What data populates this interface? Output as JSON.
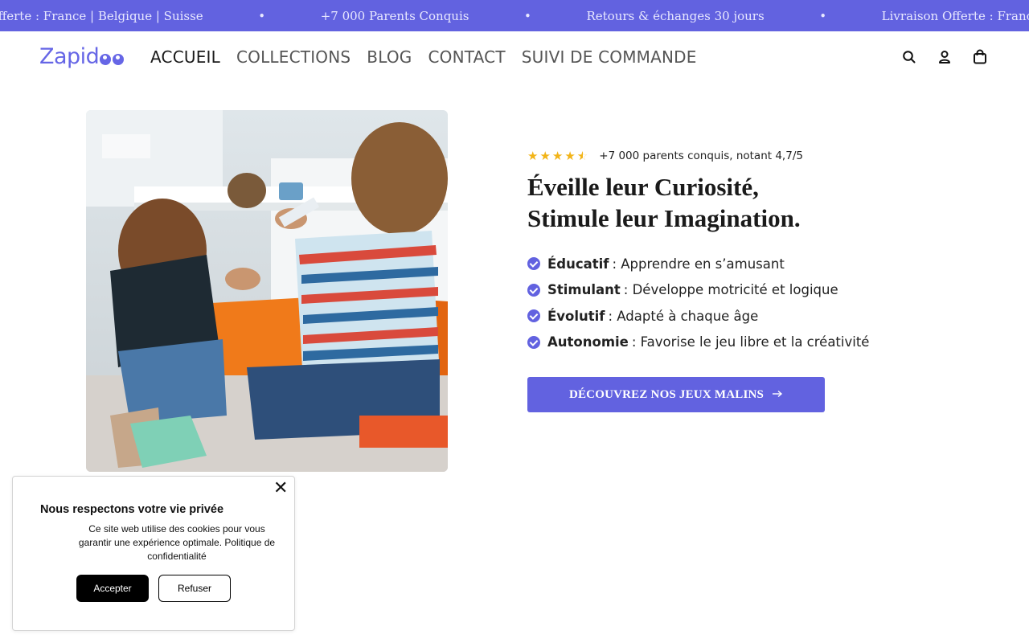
{
  "announcement": {
    "items": [
      "Livraison Offerte : France | Belgique | Suisse",
      "+7 000 Parents Conquis",
      "Retours & échanges 30 jours",
      "Livraison Offerte : France | Belgique | Suisse"
    ],
    "separator": "•"
  },
  "header": {
    "logo": "Zapid",
    "nav": [
      "ACCUEIL",
      "COLLECTIONS",
      "BLOG",
      "CONTACT",
      "SUIVI DE COMMANDE"
    ],
    "active_nav": "ACCUEIL",
    "icons": [
      "search-icon",
      "account-icon",
      "cart-icon"
    ]
  },
  "hero": {
    "rating": {
      "stars": 4.5,
      "text": "+7 000 parents conquis, notant 4,7/5"
    },
    "title_line1": "Éveille leur Curiosité,",
    "title_line2": "Stimule leur Imagination.",
    "features": [
      {
        "label": "Éducatif",
        "text": ": Apprendre en s’amusant"
      },
      {
        "label": "Stimulant",
        "text": ": Développe motricité et logique"
      },
      {
        "label": "Évolutif",
        "text": ": Adapté à chaque âge"
      },
      {
        "label": "Autonomie",
        "text": ": Favorise le jeu libre et la créativité"
      }
    ],
    "cta_label": "DÉCOUVREZ NOS JEUX MALINS"
  },
  "cookie": {
    "title": "Nous respectons votre vie privée",
    "body": "Ce site web utilise des cookies pour vous garantir une expérience optimale. Politique de confidentialité",
    "accept_label": "Accepter",
    "refuse_label": "Refuser"
  },
  "colors": {
    "brand": "#6262e0",
    "star": "#f2b418",
    "text": "#1a1a1a"
  }
}
